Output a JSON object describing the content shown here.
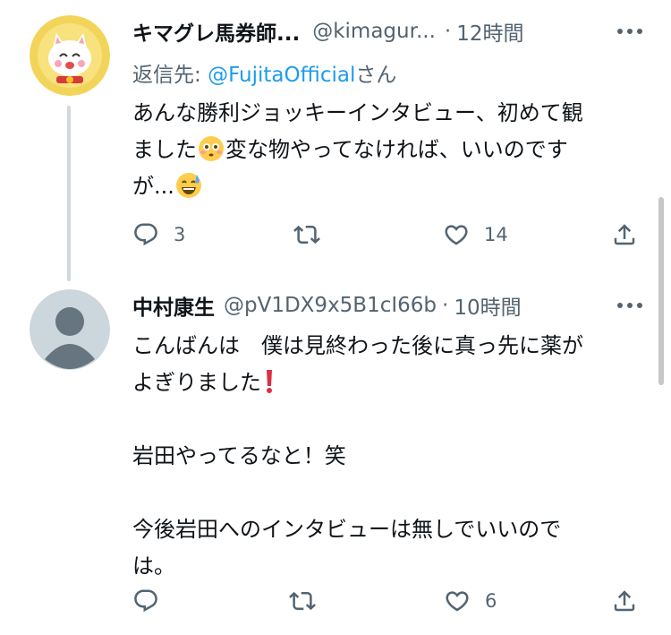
{
  "tweets": [
    {
      "name": "キマグレ馬券師...",
      "handle": "@kimagur...",
      "separator": "·",
      "time": "12時間",
      "reply_prefix": "返信先: ",
      "reply_mention": "@FujitaOfficial",
      "reply_suffix": "さん",
      "text_1": "あんな勝利ジョッキーインタビュー、初めて観\nました",
      "text_2": "変な物やってなければ、いいのです\nが...",
      "actions": {
        "reply_count": "3",
        "retweet_count": "",
        "like_count": "14"
      }
    },
    {
      "name": "中村康生",
      "handle": "@pV1DX9x5B1cI66b",
      "separator": "·",
      "time": "10時間",
      "text_1": "こんばんは　僕は見終わった後に真っ先に薬が\nよぎりました",
      "text_2": "\n\n岩田やってるなと！笑\n\n今後岩田へのインタビューは無しでいいので\nは。",
      "actions": {
        "reply_count": "",
        "retweet_count": "",
        "like_count": "6"
      }
    }
  ],
  "colors": {
    "accent": "#1d9bf0",
    "secondary_text": "#536471",
    "thread_line": "#cfd9de"
  },
  "icons": [
    "reply-icon",
    "retweet-icon",
    "like-icon",
    "share-icon",
    "more-icon",
    "flushed-face-emoji",
    "sweat-smile-emoji",
    "exclamation-emoji"
  ]
}
